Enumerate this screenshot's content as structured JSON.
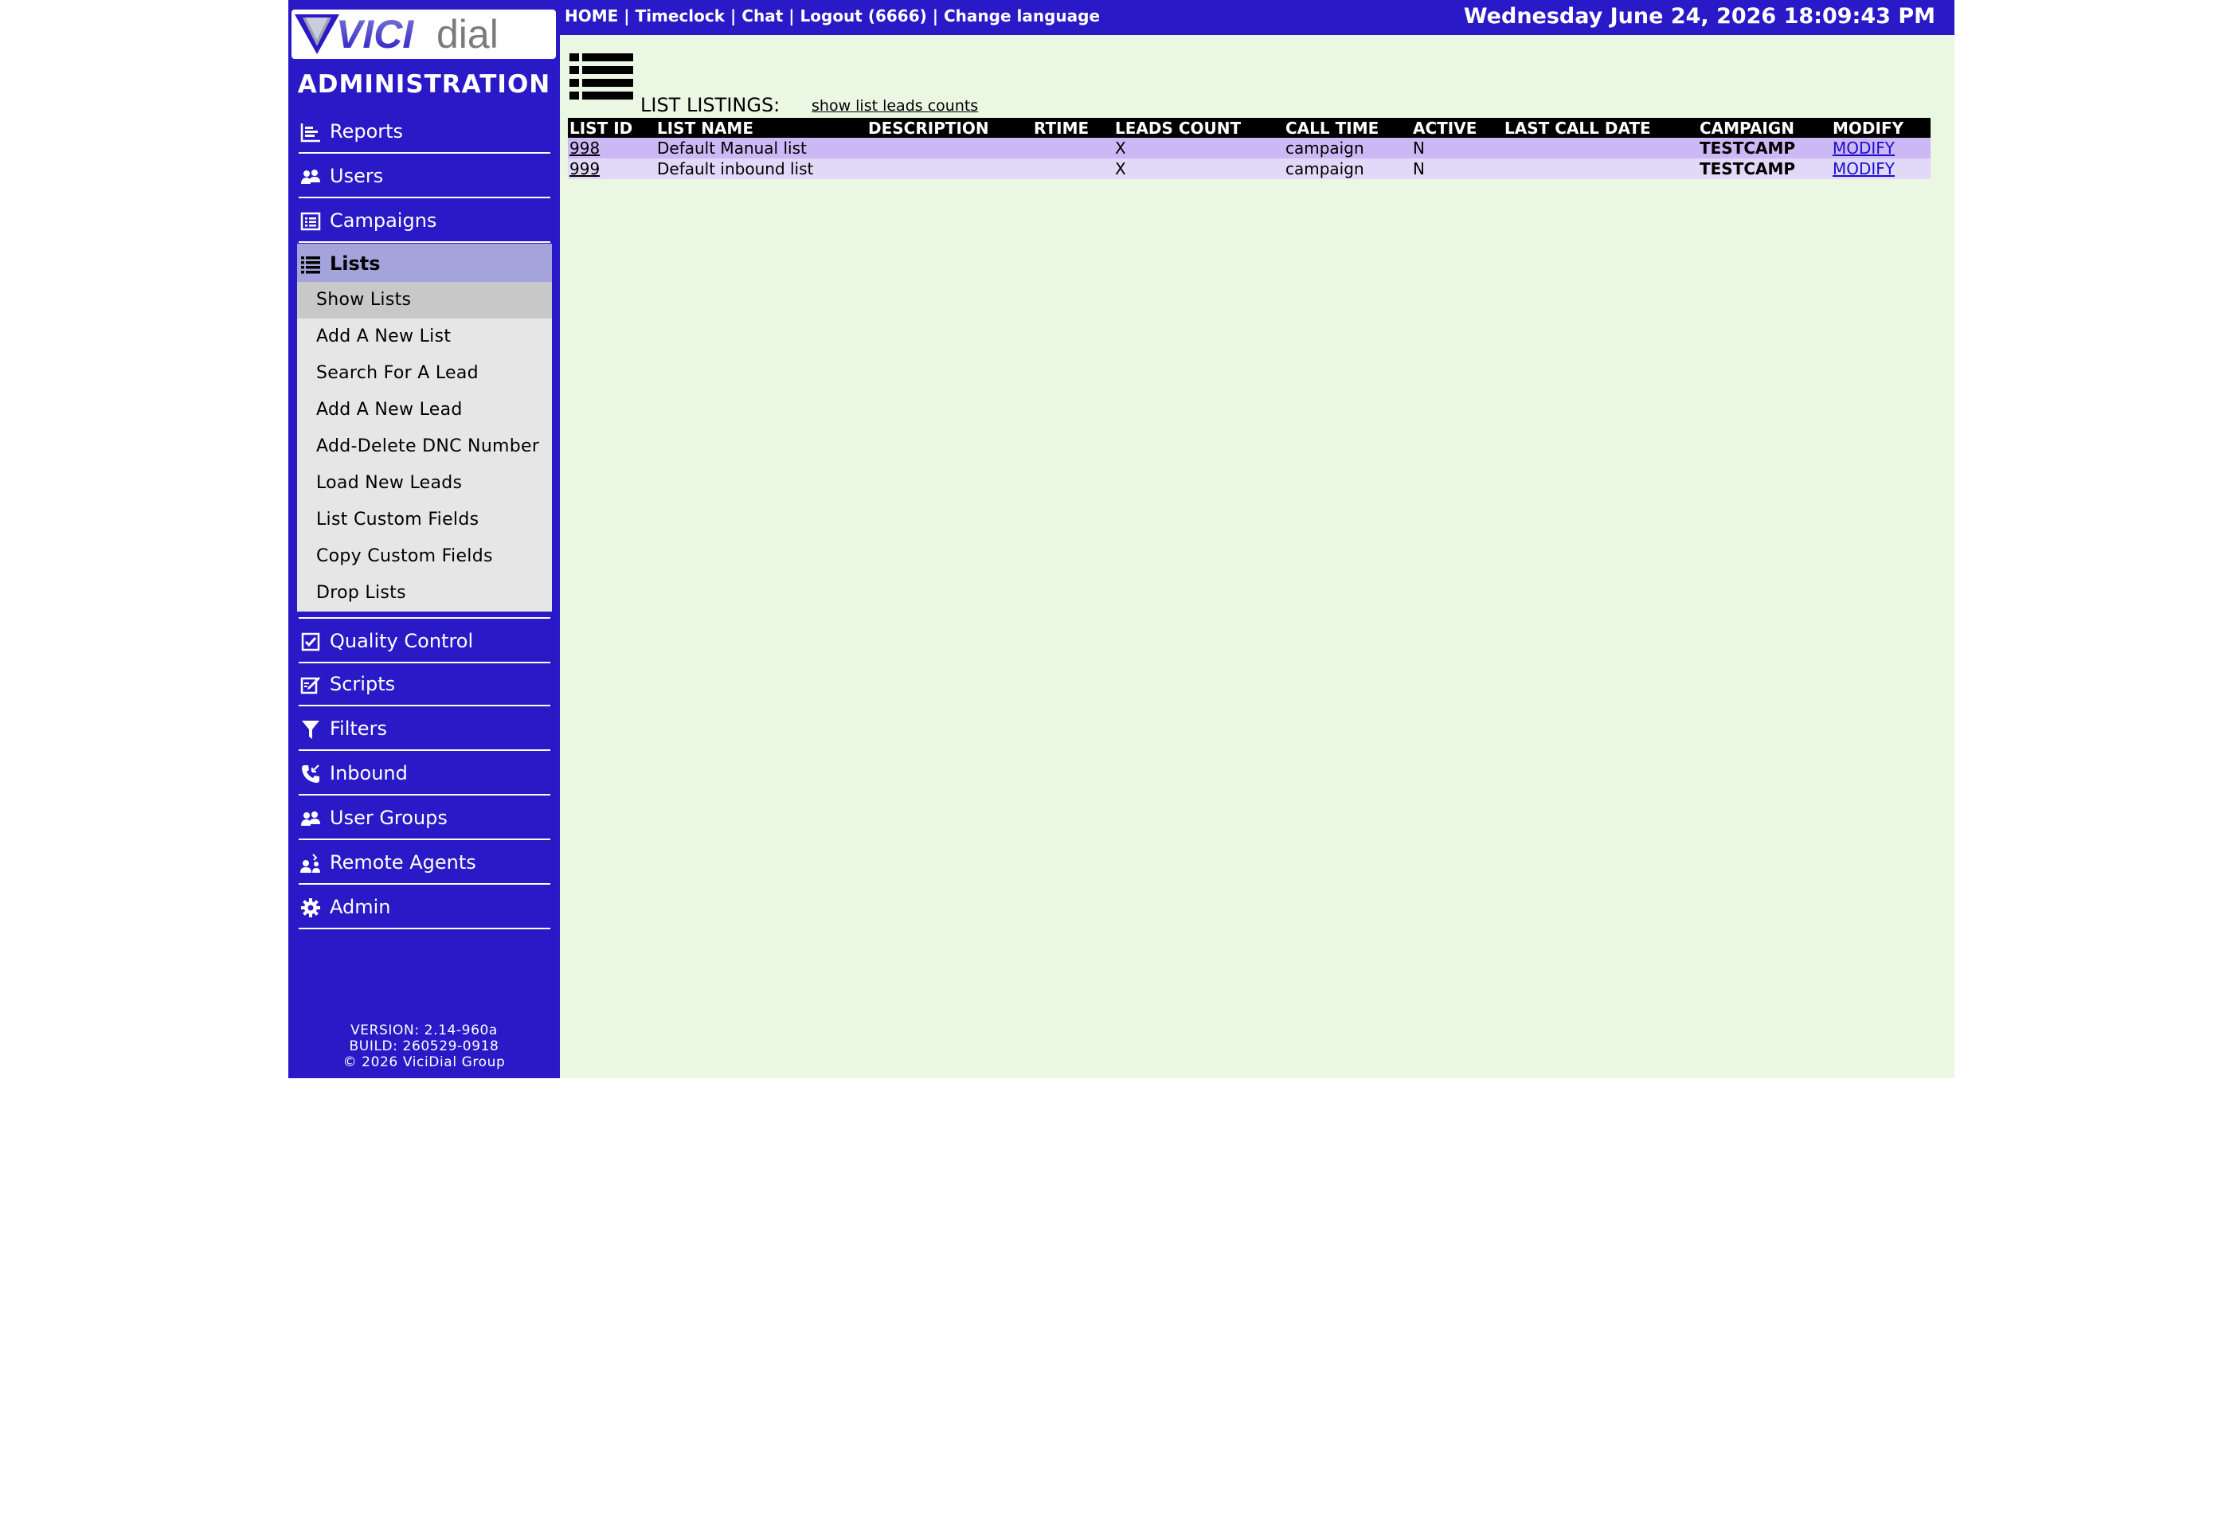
{
  "brand": {
    "logo_text": "VICIdial",
    "section_title": "ADMINISTRATION"
  },
  "colors": {
    "navy": "#2a19c7",
    "content_bg": "#eaf7e3",
    "active_nav": "#a5a3dc",
    "row_a": "#cbb8f5",
    "row_b": "#e1d9f7",
    "campaign": "#ff0000"
  },
  "topbar": {
    "links": [
      "HOME",
      "Timeclock",
      "Chat",
      "Logout (6666)",
      "Change language"
    ],
    "separator": " | ",
    "datetime": "Wednesday June 24, 2026 18:09:43 PM"
  },
  "sidebar": {
    "items": [
      {
        "label": "Reports",
        "icon": "bar-chart-icon"
      },
      {
        "label": "Users",
        "icon": "users-icon"
      },
      {
        "label": "Campaigns",
        "icon": "list-box-icon"
      },
      {
        "label": "Lists",
        "icon": "list-icon"
      },
      {
        "label": "Quality Control",
        "icon": "checkbox-icon"
      },
      {
        "label": "Scripts",
        "icon": "edit-icon"
      },
      {
        "label": "Filters",
        "icon": "filter-icon"
      },
      {
        "label": "Inbound",
        "icon": "phone-icon"
      },
      {
        "label": "User Groups",
        "icon": "user-groups-icon"
      },
      {
        "label": "Remote Agents",
        "icon": "remote-agent-icon"
      },
      {
        "label": "Admin",
        "icon": "gear-icon"
      }
    ],
    "active": "Lists",
    "lists_submenu": [
      "Show Lists",
      "Add A New List",
      "Search For A Lead",
      "Add A New Lead",
      "Add-Delete DNC Number",
      "Load New Leads",
      "List Custom Fields",
      "Copy Custom Fields",
      "Drop Lists"
    ],
    "active_submenu": "Show Lists",
    "version": [
      "VERSION: 2.14-960a",
      "BUILD: 260529-0918",
      "© 2026 ViciDial Group"
    ]
  },
  "main": {
    "title": "LIST LISTINGS:",
    "show_counts_link": "show list leads counts",
    "columns": [
      "LIST ID",
      "LIST NAME",
      "DESCRIPTION",
      "RTIME",
      "LEADS COUNT",
      "CALL TIME",
      "ACTIVE",
      "LAST CALL DATE",
      "CAMPAIGN",
      "MODIFY"
    ],
    "rows": [
      {
        "list_id": "998",
        "list_name": "Default Manual list",
        "description": "",
        "rtime": "",
        "leads_count": "X",
        "call_time": "campaign",
        "active": "N",
        "last_call_date": "",
        "campaign": "TESTCAMP",
        "modify": "MODIFY"
      },
      {
        "list_id": "999",
        "list_name": "Default inbound list",
        "description": "",
        "rtime": "",
        "leads_count": "X",
        "call_time": "campaign",
        "active": "N",
        "last_call_date": "",
        "campaign": "TESTCAMP",
        "modify": "MODIFY"
      }
    ]
  }
}
